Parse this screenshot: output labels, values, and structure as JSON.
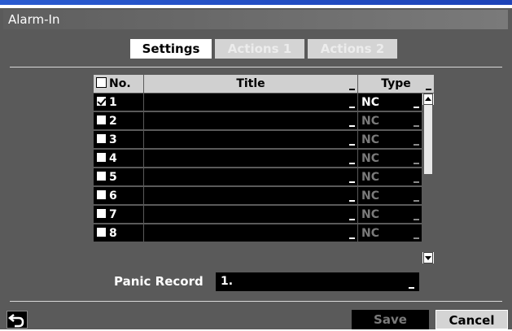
{
  "window": {
    "title": "Alarm-In"
  },
  "tabs": [
    {
      "label": "Settings",
      "active": true
    },
    {
      "label": "Actions 1",
      "active": false
    },
    {
      "label": "Actions 2",
      "active": false
    }
  ],
  "table": {
    "headers": {
      "no": "No.",
      "title": "Title",
      "type": "Type"
    },
    "rows": [
      {
        "no": "1",
        "checked": true,
        "title": "",
        "type": "NC",
        "enabled": true
      },
      {
        "no": "2",
        "checked": false,
        "title": "",
        "type": "NC",
        "enabled": false
      },
      {
        "no": "3",
        "checked": false,
        "title": "",
        "type": "NC",
        "enabled": false
      },
      {
        "no": "4",
        "checked": false,
        "title": "",
        "type": "NC",
        "enabled": false
      },
      {
        "no": "5",
        "checked": false,
        "title": "",
        "type": "NC",
        "enabled": false
      },
      {
        "no": "6",
        "checked": false,
        "title": "",
        "type": "NC",
        "enabled": false
      },
      {
        "no": "7",
        "checked": false,
        "title": "",
        "type": "NC",
        "enabled": false
      },
      {
        "no": "8",
        "checked": false,
        "title": "",
        "type": "NC",
        "enabled": false
      }
    ]
  },
  "panic_record": {
    "label": "Panic Record",
    "value": "1."
  },
  "buttons": {
    "save": "Save",
    "cancel": "Cancel"
  },
  "icons": {
    "back": "back-arrow-icon"
  },
  "colors": {
    "window_bg": "#5a5a5a",
    "blue_bar": "#2a5bd0",
    "cell_bg": "#000000",
    "header_bg": "#d0d0d0"
  }
}
